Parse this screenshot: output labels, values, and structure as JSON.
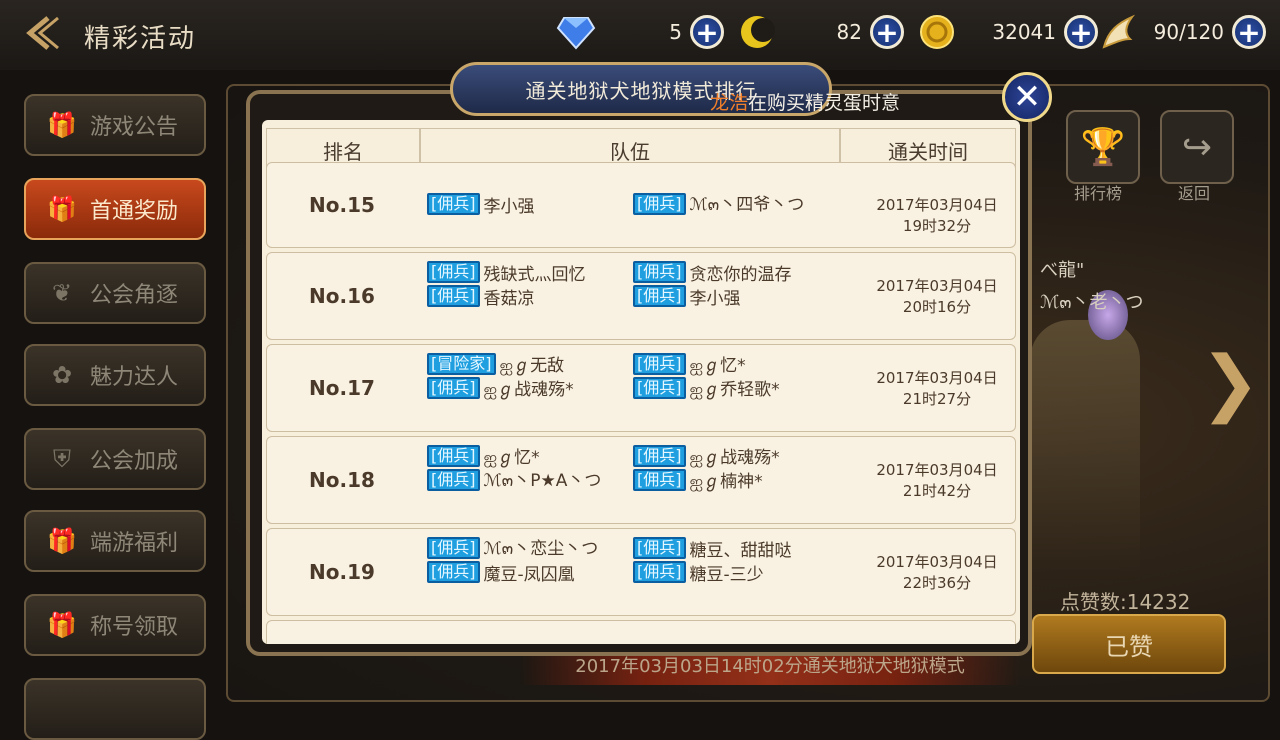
{
  "header": {
    "title": "精彩活动",
    "resources": [
      {
        "icon": "diamond-icon",
        "value": "5"
      },
      {
        "icon": "crescent-coin-icon",
        "value": "82"
      },
      {
        "icon": "gold-coin-icon",
        "value": "32041"
      },
      {
        "icon": "wing-stamina-icon",
        "value": "90/120"
      }
    ]
  },
  "sidebar": {
    "items": [
      {
        "label": "游戏公告"
      },
      {
        "label": "首通奖励",
        "active": true
      },
      {
        "label": "公会角逐"
      },
      {
        "label": "魅力达人"
      },
      {
        "label": "公会加成"
      },
      {
        "label": "端游福利"
      },
      {
        "label": "称号领取"
      }
    ]
  },
  "background": {
    "ranking_label": "排行榜",
    "return_label": "返回",
    "char_name": "べ龍\"",
    "char_sub": "ℳ๓丶老丶つ",
    "likes": "点赞数:14232",
    "liked_button": "已赞",
    "banner": "2017年03月03日14时02分通关地狱犬地狱模式"
  },
  "modal": {
    "title": "通关地狱犬地狱模式排行",
    "ticker_name": "龙浩",
    "ticker_text": "在购买精灵蛋时意",
    "columns": {
      "rank": "排名",
      "team": "队伍",
      "time": "通关时间"
    },
    "rows": [
      {
        "rank": "No.15",
        "members": [
          {
            "tag": "[佣兵]",
            "name": "李小强"
          },
          {
            "tag": "[佣兵]",
            "name": "ℳ๓丶四爷丶つ"
          }
        ],
        "date": "2017年03月04日",
        "clock": "19时32分"
      },
      {
        "rank": "No.16",
        "members": [
          {
            "tag": "[佣兵]",
            "name": "残缺式灬回忆"
          },
          {
            "tag": "[佣兵]",
            "name": "香菇凉"
          },
          {
            "tag": "[佣兵]",
            "name": "贪恋你的温存"
          },
          {
            "tag": "[佣兵]",
            "name": "李小强"
          }
        ],
        "date": "2017年03月04日",
        "clock": "20时16分"
      },
      {
        "rank": "No.17",
        "members": [
          {
            "tag": "[冒险家]",
            "name": "ஐℊ无敌"
          },
          {
            "tag": "[佣兵]",
            "name": "ஐℊ战魂殇*"
          },
          {
            "tag": "[佣兵]",
            "name": "ஐℊ忆*"
          },
          {
            "tag": "[佣兵]",
            "name": "ஐℊ乔轻歌*"
          }
        ],
        "date": "2017年03月04日",
        "clock": "21时27分"
      },
      {
        "rank": "No.18",
        "members": [
          {
            "tag": "[佣兵]",
            "name": "ஐℊ忆*"
          },
          {
            "tag": "[佣兵]",
            "name": "ℳ๓丶P★A丶つ"
          },
          {
            "tag": "[佣兵]",
            "name": "ஐℊ战魂殇*"
          },
          {
            "tag": "[佣兵]",
            "name": "ஐℊ楠神*"
          }
        ],
        "date": "2017年03月04日",
        "clock": "21时42分"
      },
      {
        "rank": "No.19",
        "members": [
          {
            "tag": "[佣兵]",
            "name": "ℳ๓丶恋尘丶つ"
          },
          {
            "tag": "[佣兵]",
            "name": "魔豆-凤囚凰"
          },
          {
            "tag": "[佣兵]",
            "name": "糖豆、甜甜哒"
          },
          {
            "tag": "[佣兵]",
            "name": "糖豆-三少"
          }
        ],
        "date": "2017年03月04日",
        "clock": "22时36分"
      }
    ]
  }
}
